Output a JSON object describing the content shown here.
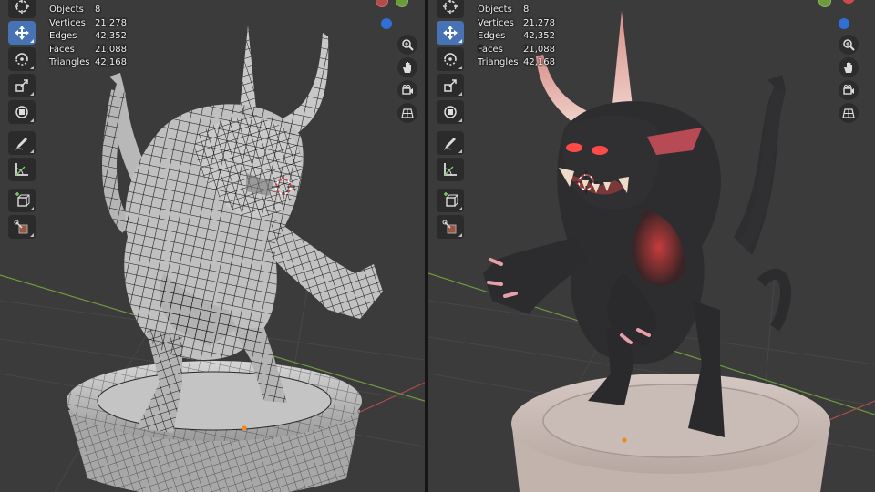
{
  "stats": {
    "objects_label": "Objects",
    "objects_value": "8",
    "vertices_label": "Vertices",
    "vertices_value": "21,278",
    "edges_label": "Edges",
    "edges_value": "42,352",
    "faces_label": "Faces",
    "faces_value": "21,088",
    "triangles_label": "Triangles",
    "triangles_value": "42,168"
  },
  "viewports": {
    "left": {
      "shading": "wireframe"
    },
    "right": {
      "shading": "material-preview"
    }
  },
  "toolbar_tools": [
    "cursor-icon",
    "move-icon",
    "rotate-icon",
    "scale-icon",
    "transform-icon",
    "annotate-icon",
    "measure-icon",
    "add-cube-icon",
    "extrude-icon"
  ],
  "navigation_tools": [
    "zoom-icon",
    "pan-hand-icon",
    "camera-icon",
    "grid-view-icon"
  ],
  "colors": {
    "viewport_bg": "#3b3b3b",
    "active_tool": "#4772b3",
    "tool_bg": "#2b2b2b",
    "axis_x": "#b04c4c",
    "axis_y": "#6d9a3c",
    "gizmo_z": "#2f6fd6"
  }
}
